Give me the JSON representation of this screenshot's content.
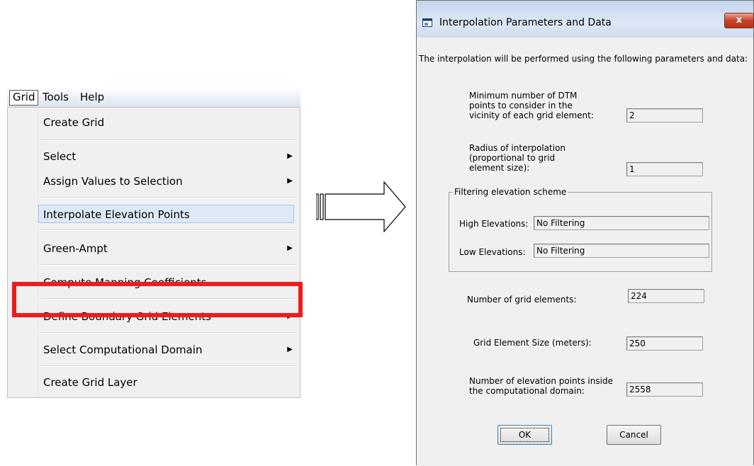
{
  "menubar": {
    "items": [
      "Grid",
      "Tools",
      "Help"
    ]
  },
  "menu": {
    "items": [
      {
        "label": "Create Grid",
        "submenu": false
      },
      {
        "label": "Select",
        "submenu": true
      },
      {
        "label": "Assign Values to Selection",
        "submenu": true
      },
      {
        "label": "Interpolate Elevation Points",
        "submenu": false,
        "highlighted": true
      },
      {
        "label": "Green-Ampt",
        "submenu": true
      },
      {
        "label": "Compute Manning Coefficients...",
        "submenu": false
      },
      {
        "label": "Define Boundary Grid Elements",
        "submenu": true
      },
      {
        "label": "Select Computational Domain",
        "submenu": true
      },
      {
        "label": "Create Grid Layer",
        "submenu": false
      }
    ],
    "submenu_arrow": "▶",
    "highlight_color": "#ee1c1c"
  },
  "dialog": {
    "title": "Interpolation Parameters and Data",
    "close_label": "x",
    "intro": "The interpolation will be performed using the following parameters and data:",
    "min_points": {
      "label_lines": [
        "Minimum number of DTM",
        "points to consider in the",
        "vicinity of each grid element:"
      ],
      "value": "2"
    },
    "radius": {
      "label_lines": [
        "Radius of interpolation",
        "(proportional to grid",
        "element size):"
      ],
      "value": "1"
    },
    "filtering": {
      "group_label": "Filtering elevation scheme",
      "high_label": "High Elevations:",
      "high_value": "No Filtering",
      "low_label": "Low Elevations:",
      "low_value": "No Filtering"
    },
    "grid_elements": {
      "label": "Number of grid elements:",
      "value": "224"
    },
    "element_size": {
      "label": "Grid Element Size (meters):",
      "value": "250"
    },
    "elevation_points": {
      "label_lines": [
        "Number of elevation points inside",
        "the computational domain:"
      ],
      "value": "2558"
    },
    "ok_label": "OK",
    "cancel_label": "Cancel"
  }
}
